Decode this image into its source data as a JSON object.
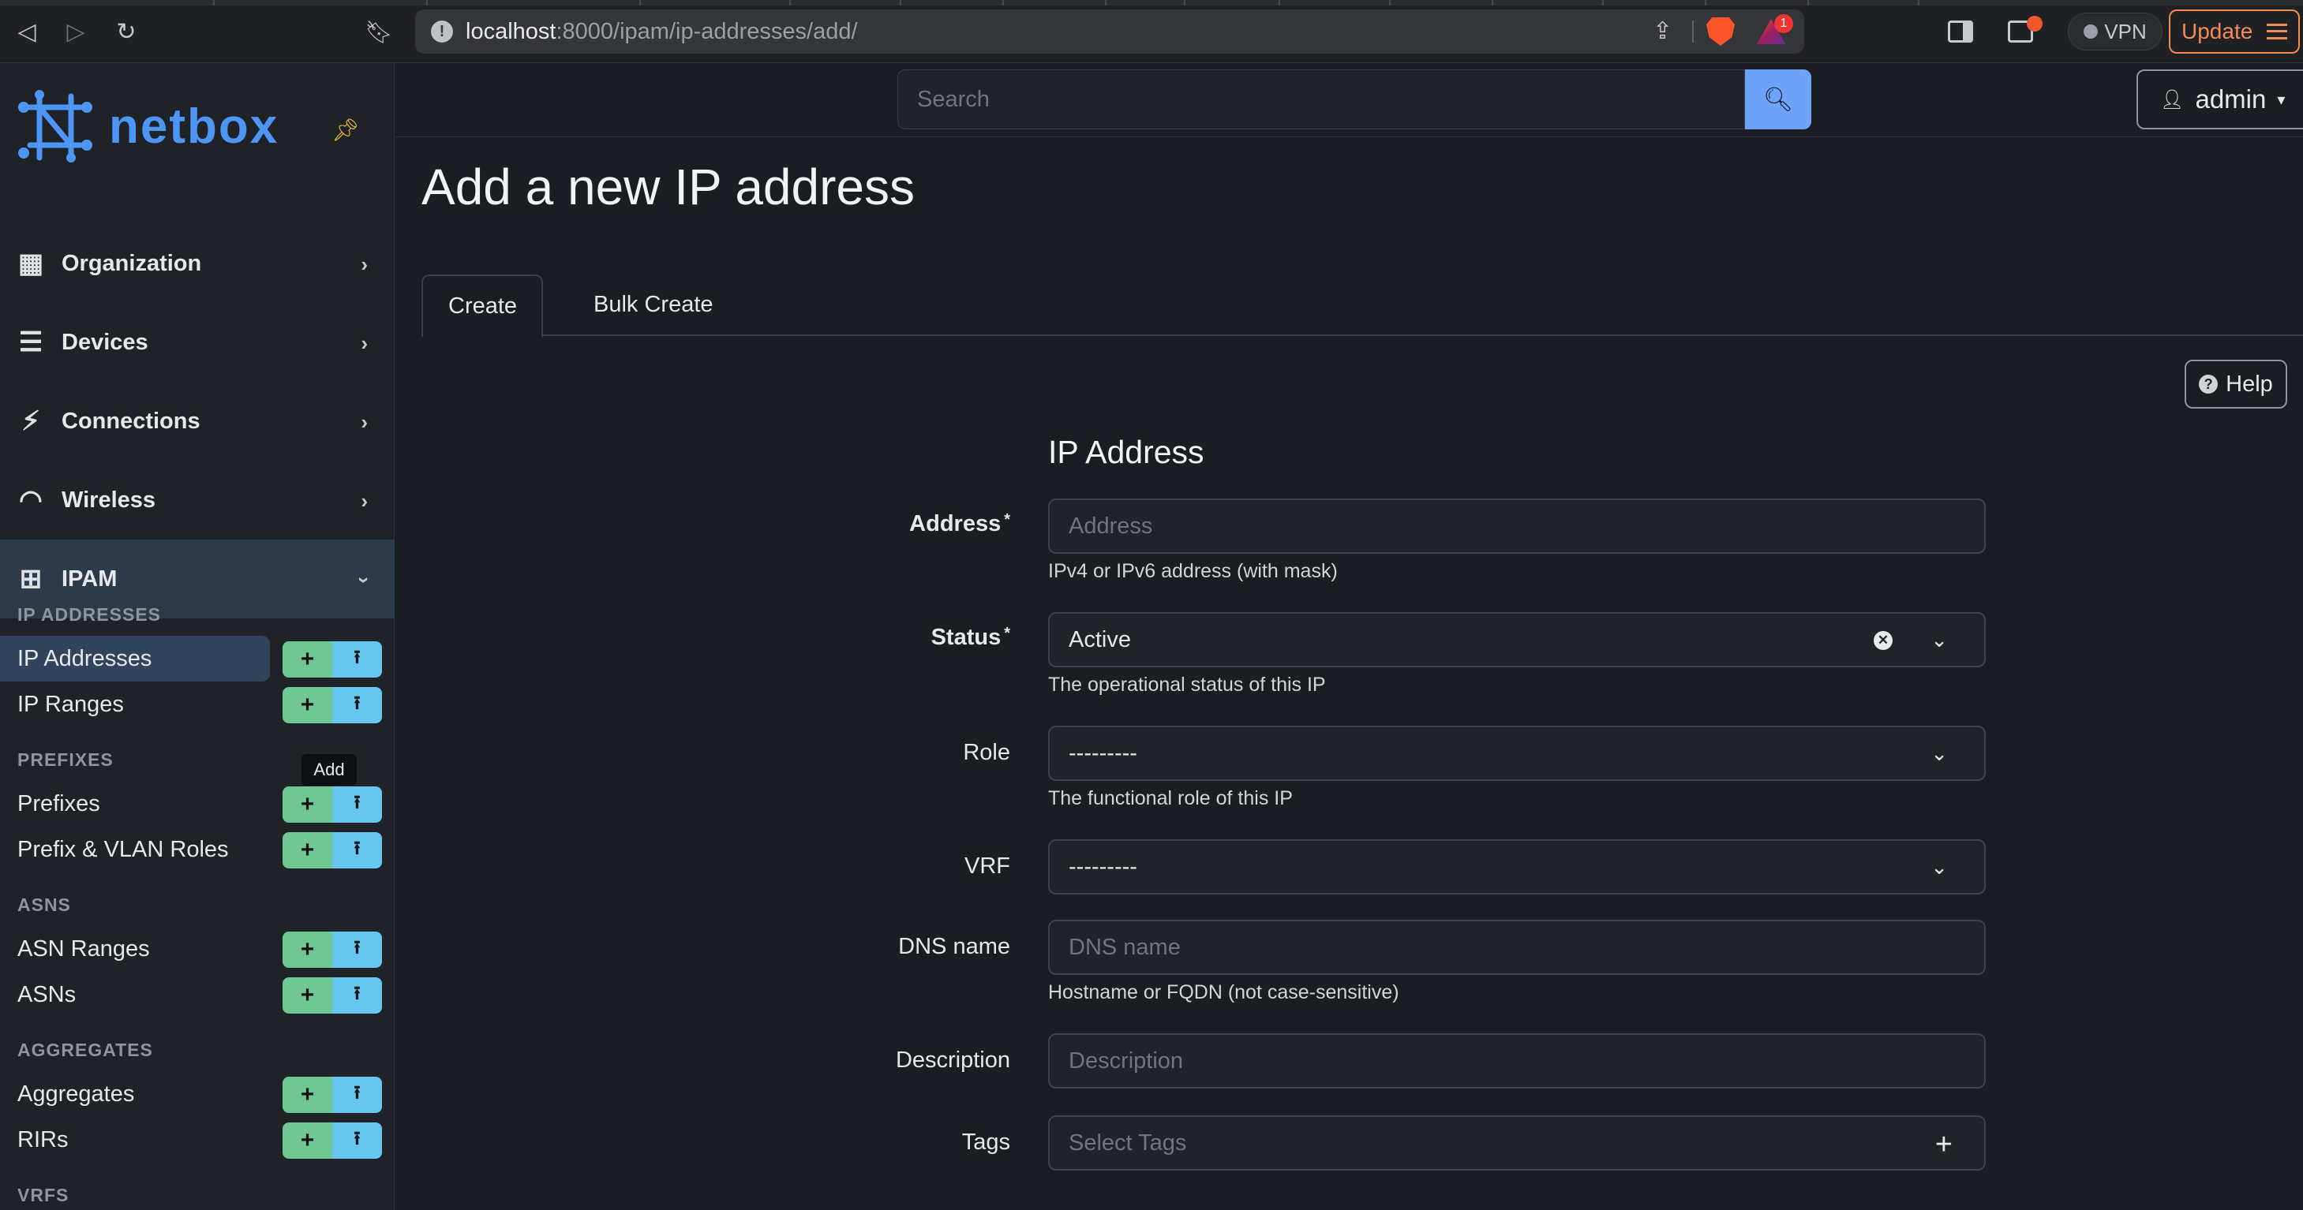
{
  "browser": {
    "url_host": "localhost",
    "url_path": ":8000/ipam/ip-addresses/add/",
    "vpn_label": "VPN",
    "update_label": "Update",
    "rewards_badge": "1"
  },
  "sidebar": {
    "logo_text": "netbox",
    "menu": [
      {
        "label": "Organization"
      },
      {
        "label": "Devices"
      },
      {
        "label": "Connections"
      },
      {
        "label": "Wireless"
      },
      {
        "label": "IPAM"
      }
    ],
    "sections": [
      {
        "heading": "IP ADDRESSES",
        "items": [
          {
            "label": "IP Addresses"
          },
          {
            "label": "IP Ranges"
          }
        ]
      },
      {
        "heading": "PREFIXES",
        "items": [
          {
            "label": "Prefixes"
          },
          {
            "label": "Prefix & VLAN Roles"
          }
        ]
      },
      {
        "heading": "ASNS",
        "items": [
          {
            "label": "ASN Ranges"
          },
          {
            "label": "ASNs"
          }
        ]
      },
      {
        "heading": "AGGREGATES",
        "items": [
          {
            "label": "Aggregates"
          },
          {
            "label": "RIRs"
          }
        ]
      },
      {
        "heading": "VRFS",
        "items": []
      }
    ],
    "tooltip": "Add"
  },
  "topbar": {
    "search_placeholder": "Search",
    "user": "admin"
  },
  "main": {
    "title": "Add a new IP address",
    "tabs": [
      {
        "label": "Create"
      },
      {
        "label": "Bulk Create"
      }
    ],
    "help_label": "Help",
    "form_title": "IP Address",
    "fields": {
      "address": {
        "label": "Address",
        "placeholder": "Address",
        "hint": "IPv4 or IPv6 address (with mask)"
      },
      "status": {
        "label": "Status",
        "value": "Active",
        "hint": "The operational status of this IP"
      },
      "role": {
        "label": "Role",
        "value": "---------",
        "hint": "The functional role of this IP"
      },
      "vrf": {
        "label": "VRF",
        "value": "---------"
      },
      "dns": {
        "label": "DNS name",
        "placeholder": "DNS name",
        "hint": "Hostname or FQDN (not case-sensitive)"
      },
      "description": {
        "label": "Description",
        "placeholder": "Description"
      },
      "tags": {
        "label": "Tags",
        "placeholder": "Select Tags"
      }
    }
  },
  "colors": {
    "accent": "#4d96f5",
    "add_button": "#6fc893",
    "import_button": "#67c7ef",
    "search_button": "#6ea3f7",
    "update": "#f28b54"
  }
}
